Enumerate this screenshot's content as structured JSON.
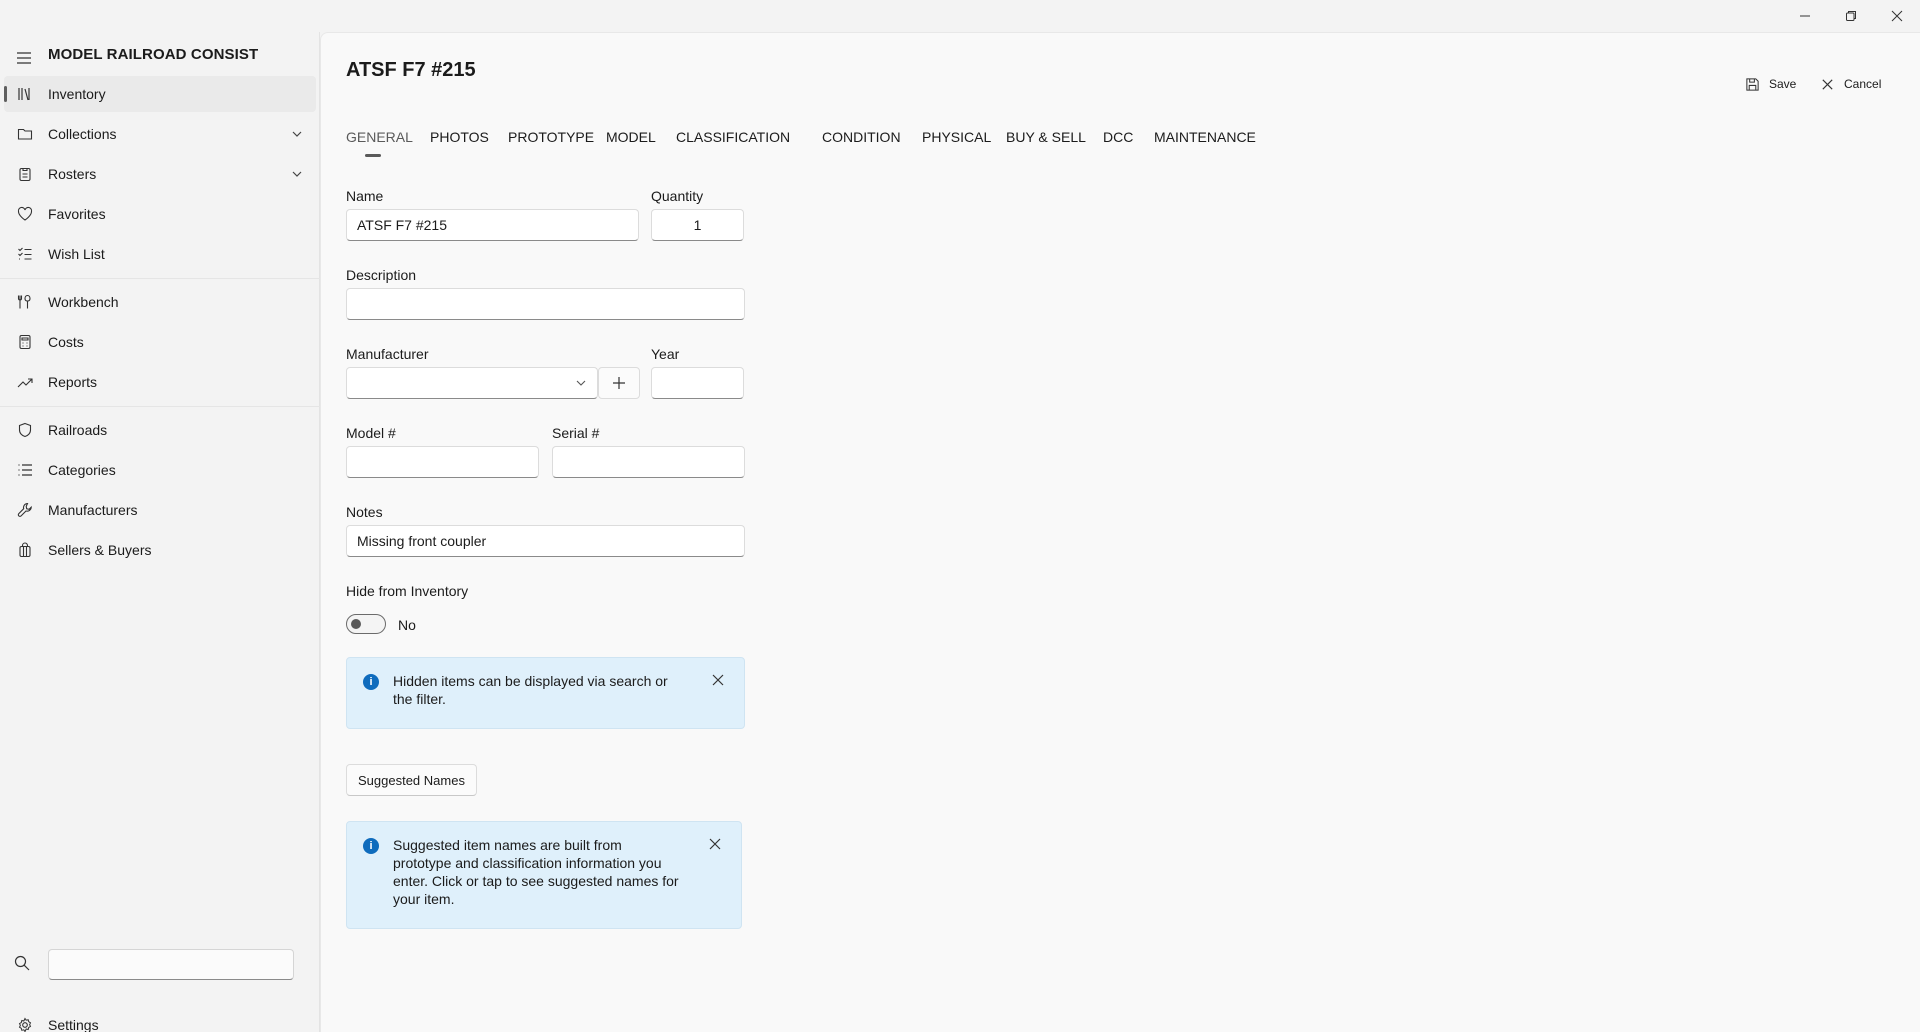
{
  "window": {
    "controls": [
      {
        "icon": "minimize-icon"
      },
      {
        "icon": "restore-icon"
      },
      {
        "icon": "close-icon"
      }
    ]
  },
  "sidebar": {
    "app_title": "MODEL RAILROAD CONSIST",
    "items": [
      {
        "label": "Inventory",
        "icon": "library-icon",
        "active": true
      },
      {
        "label": "Collections",
        "icon": "folder-icon",
        "expandable": true
      },
      {
        "label": "Rosters",
        "icon": "clipboard-icon",
        "expandable": true
      },
      {
        "label": "Favorites",
        "icon": "heart-icon"
      },
      {
        "label": "Wish List",
        "icon": "checklist-icon"
      },
      {
        "label": "Workbench",
        "icon": "tools-icon"
      },
      {
        "label": "Costs",
        "icon": "calculator-icon"
      },
      {
        "label": "Reports",
        "icon": "trending-icon"
      },
      {
        "label": "Railroads",
        "icon": "shield-icon"
      },
      {
        "label": "Categories",
        "icon": "list-icon"
      },
      {
        "label": "Manufacturers",
        "icon": "wrench-icon"
      },
      {
        "label": "Sellers & Buyers",
        "icon": "shopping-bag-icon"
      }
    ],
    "search": {
      "value": "",
      "placeholder": ""
    },
    "settings_label": "Settings"
  },
  "page": {
    "title": "ATSF F7 #215",
    "save_label": "Save",
    "cancel_label": "Cancel"
  },
  "tabs": [
    {
      "label": "GENERAL",
      "active": true
    },
    {
      "label": "PHOTOS"
    },
    {
      "label": "PROTOTYPE"
    },
    {
      "label": "MODEL"
    },
    {
      "label": "CLASSIFICATION"
    },
    {
      "label": "CONDITION"
    },
    {
      "label": "PHYSICAL"
    },
    {
      "label": "BUY & SELL"
    },
    {
      "label": "DCC"
    },
    {
      "label": "MAINTENANCE"
    }
  ],
  "form": {
    "name_label": "Name",
    "name_value": "ATSF F7 #215",
    "quantity_label": "Quantity",
    "quantity_value": "1",
    "description_label": "Description",
    "description_value": "",
    "manufacturer_label": "Manufacturer",
    "manufacturer_value": "",
    "year_label": "Year",
    "year_value": "",
    "model_label": "Model #",
    "model_value": "",
    "serial_label": "Serial #",
    "serial_value": "",
    "notes_label": "Notes",
    "notes_value": "Missing front coupler",
    "hide_label": "Hide from Inventory",
    "hide_state": "No",
    "hidden_info_line1": "Hidden items can be displayed via search or",
    "hidden_info_line2": "the filter.",
    "suggested_button": "Suggested Names",
    "suggested_info_line1": "Suggested item names are built from",
    "suggested_info_line2": "prototype and classification information you",
    "suggested_info_line3": "enter. Click or tap to see suggested names for",
    "suggested_info_line4": "your item."
  }
}
